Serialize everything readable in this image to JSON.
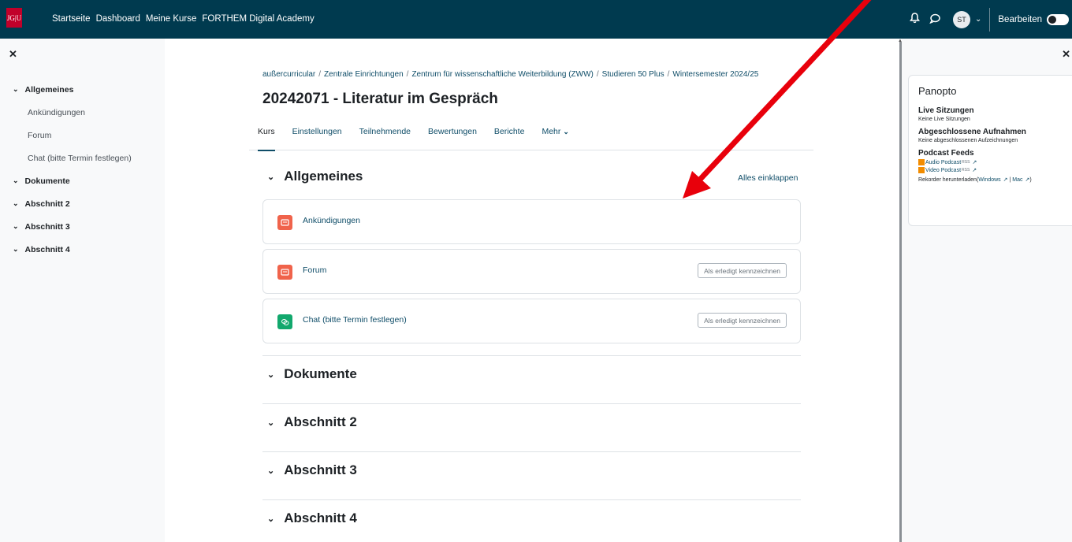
{
  "navbar": {
    "logo_text": "JG|U",
    "links": [
      "Startseite",
      "Dashboard",
      "Meine Kurse",
      "FORTHEM Digital Academy"
    ],
    "avatar_initials": "ST",
    "edit_mode_label": "Bearbeiten"
  },
  "left_drawer": {
    "items": [
      {
        "label": "Allgemeines",
        "type": "section"
      },
      {
        "label": "Ankündigungen",
        "type": "sub"
      },
      {
        "label": "Forum",
        "type": "sub"
      },
      {
        "label": "Chat (bitte Termin festlegen)",
        "type": "sub"
      },
      {
        "label": "Dokumente",
        "type": "section"
      },
      {
        "label": "Abschnitt 2",
        "type": "section"
      },
      {
        "label": "Abschnitt 3",
        "type": "section"
      },
      {
        "label": "Abschnitt 4",
        "type": "section"
      }
    ]
  },
  "breadcrumb": [
    "außercurricular",
    "Zentrale Einrichtungen",
    "Zentrum für wissenschaftliche Weiterbildung (ZWW)",
    "Studieren 50 Plus",
    "Wintersemester 2024/25"
  ],
  "page_title": "20242071 - Literatur im Gespräch",
  "tabs": [
    "Kurs",
    "Einstellungen",
    "Teilnehmende",
    "Bewertungen",
    "Berichte",
    "Mehr"
  ],
  "collapse_all": "Alles einklappen",
  "sections": [
    "Allgemeines",
    "Dokumente",
    "Abschnitt 2",
    "Abschnitt 3",
    "Abschnitt 4"
  ],
  "activities": [
    {
      "name": "Ankündigungen",
      "mark_done": ""
    },
    {
      "name": "Forum",
      "mark_done": "Als erledigt kennzeichnen"
    },
    {
      "name": "Chat (bitte Termin festlegen)",
      "mark_done": "Als erledigt kennzeichnen"
    }
  ],
  "panopto": {
    "title": "Panopto",
    "live_heading": "Live Sitzungen",
    "live_text": "Keine Live Sitzungen",
    "recorded_heading": "Abgeschlossene Aufnahmen",
    "recorded_text": "Keine abgeschlossenen Aufzeichnungen",
    "podcast_heading": "Podcast Feeds",
    "audio_link": "Audio Podcast",
    "video_link": "Video Podcast",
    "rss_tag": "RSS",
    "recorder_text": "Rekorder herunterladen(",
    "windows_link": "Windows",
    "mac_link": "Mac",
    "recorder_sep": " | ",
    "recorder_end": ")"
  },
  "colors": {
    "navbar": "#003a4f",
    "link": "#0f4d68",
    "forum_icon": "#f0634b",
    "chat_icon": "#12a86d",
    "arrow": "#e8000b"
  }
}
